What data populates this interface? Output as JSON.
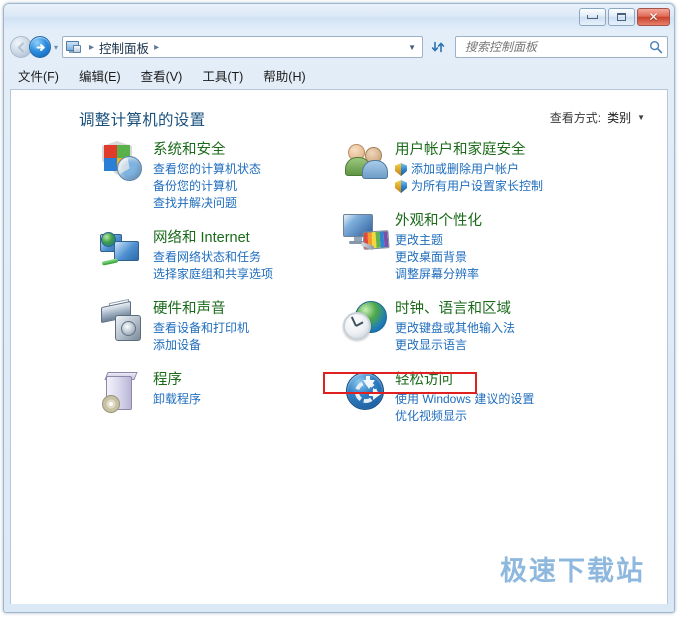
{
  "window": {
    "controls": {
      "minimize": "–",
      "maximize": "□",
      "close": "✕"
    }
  },
  "nav": {
    "back_label": "◀",
    "forward_label": "➜",
    "history_arrow": "▾",
    "breadcrumb_icon": "control-panel-icon",
    "breadcrumb_sep_1": "▸",
    "breadcrumb_text": "控制面板",
    "breadcrumb_sep_2": "▸",
    "address_chevron": "▼",
    "refresh_label": "↻"
  },
  "search": {
    "placeholder": "搜索控制面板",
    "value": "",
    "icon": "search-icon"
  },
  "menubar": {
    "items": [
      {
        "label": "文件(F)"
      },
      {
        "label": "编辑(E)"
      },
      {
        "label": "查看(V)"
      },
      {
        "label": "工具(T)"
      },
      {
        "label": "帮助(H)"
      }
    ]
  },
  "pane": {
    "title": "调整计算机的设置",
    "view_by_label": "查看方式:",
    "view_by_value": "类别",
    "view_by_arrow": "▼"
  },
  "categories": {
    "left": [
      {
        "icon": "security-shield-icon",
        "title": "系统和安全",
        "links": [
          {
            "text": "查看您的计算机状态",
            "shield": false
          },
          {
            "text": "备份您的计算机",
            "shield": false
          },
          {
            "text": "查找并解决问题",
            "shield": false
          }
        ]
      },
      {
        "icon": "network-icon",
        "title": "网络和 Internet",
        "links": [
          {
            "text": "查看网络状态和任务",
            "shield": false
          },
          {
            "text": "选择家庭组和共享选项",
            "shield": false
          }
        ]
      },
      {
        "icon": "hardware-sound-icon",
        "title": "硬件和声音",
        "links": [
          {
            "text": "查看设备和打印机",
            "shield": false
          },
          {
            "text": "添加设备",
            "shield": false
          }
        ]
      },
      {
        "icon": "programs-icon",
        "title": "程序",
        "links": [
          {
            "text": "卸载程序",
            "shield": false
          }
        ]
      }
    ],
    "right": [
      {
        "icon": "user-accounts-icon",
        "title": "用户帐户和家庭安全",
        "links": [
          {
            "text": "添加或删除用户帐户",
            "shield": true
          },
          {
            "text": "为所有用户设置家长控制",
            "shield": true
          }
        ]
      },
      {
        "icon": "appearance-icon",
        "title": "外观和个性化",
        "links": [
          {
            "text": "更改主题",
            "shield": false
          },
          {
            "text": "更改桌面背景",
            "shield": false
          },
          {
            "text": "调整屏幕分辨率",
            "shield": false
          }
        ]
      },
      {
        "icon": "clock-language-icon",
        "title": "时钟、语言和区域",
        "links": [
          {
            "text": "更改键盘或其他输入法",
            "shield": false,
            "highlighted": true
          },
          {
            "text": "更改显示语言",
            "shield": false
          }
        ]
      },
      {
        "icon": "ease-of-access-icon",
        "title": "轻松访问",
        "links": [
          {
            "text": "使用 Windows 建议的设置",
            "shield": false
          },
          {
            "text": "优化视频显示",
            "shield": false
          }
        ]
      }
    ]
  },
  "highlight": {
    "color": "#e02020",
    "target_text": "更改键盘或其他输入法"
  },
  "watermark": {
    "text": "极速下载站",
    "color": "#8fb8de"
  }
}
